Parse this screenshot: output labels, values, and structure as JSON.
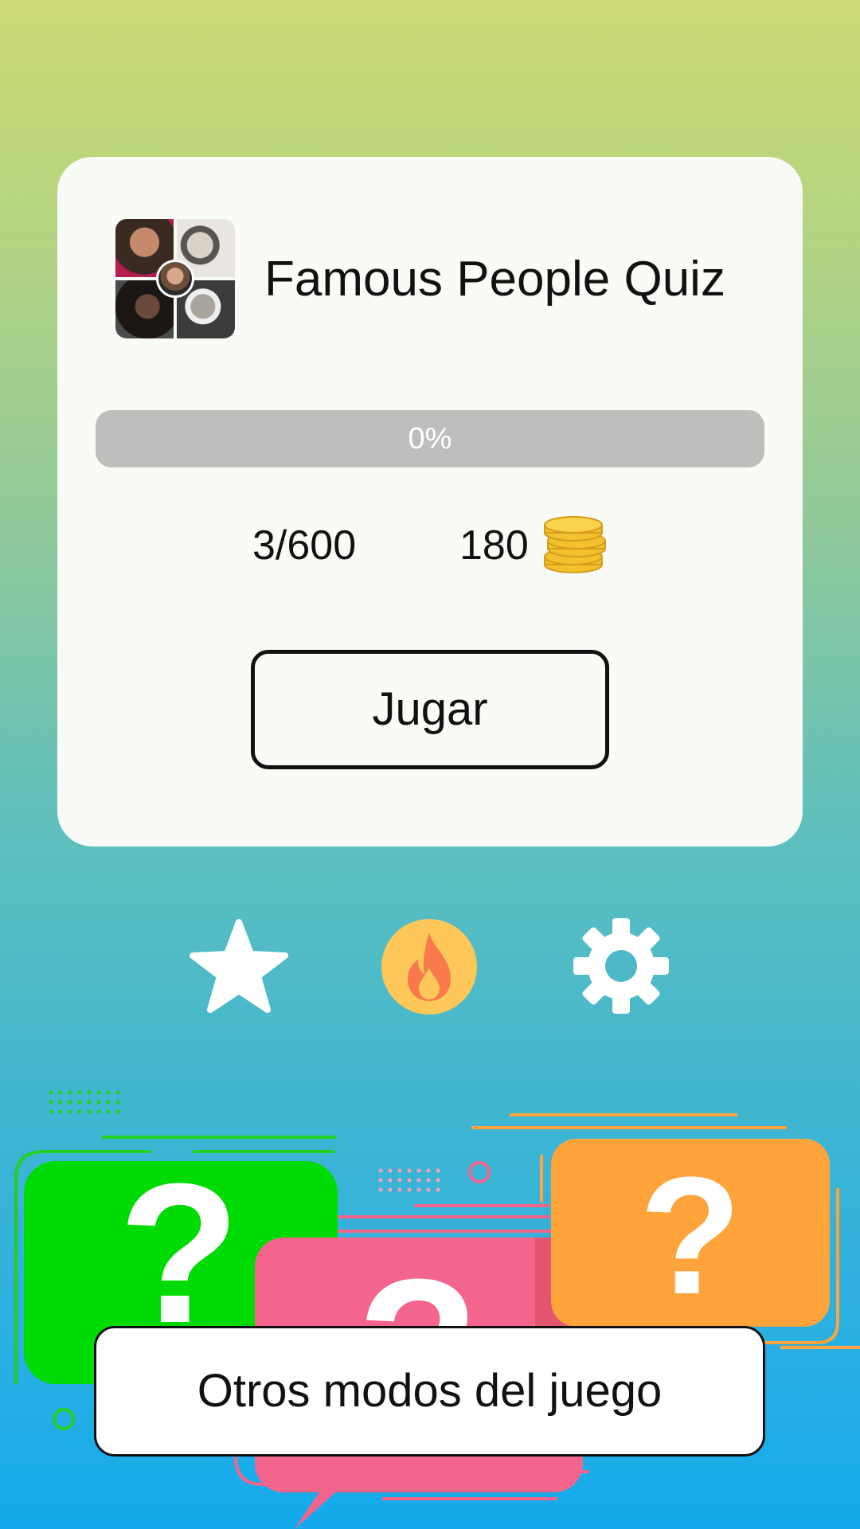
{
  "quiz": {
    "title": "Famous People Quiz",
    "icon": "famous-people-collage"
  },
  "progress": {
    "label": "0%",
    "value": 0
  },
  "stats": {
    "levels": "3/600",
    "coins": "180",
    "coins_icon": "gold-coin-stack-icon"
  },
  "actions": {
    "play_label": "Jugar",
    "other_modes_label": "Otros modos del juego"
  },
  "nav_icons": [
    "star-icon",
    "fire-icon",
    "gear-icon"
  ],
  "colors": {
    "fire_circle": "#fdc75a",
    "fire_flame": "#f87a4c",
    "green_bubble": "#00db06",
    "pink_bubble": "#f4658e",
    "orange_bubble": "#fea43a",
    "coin_gold": "#f2c12e"
  }
}
